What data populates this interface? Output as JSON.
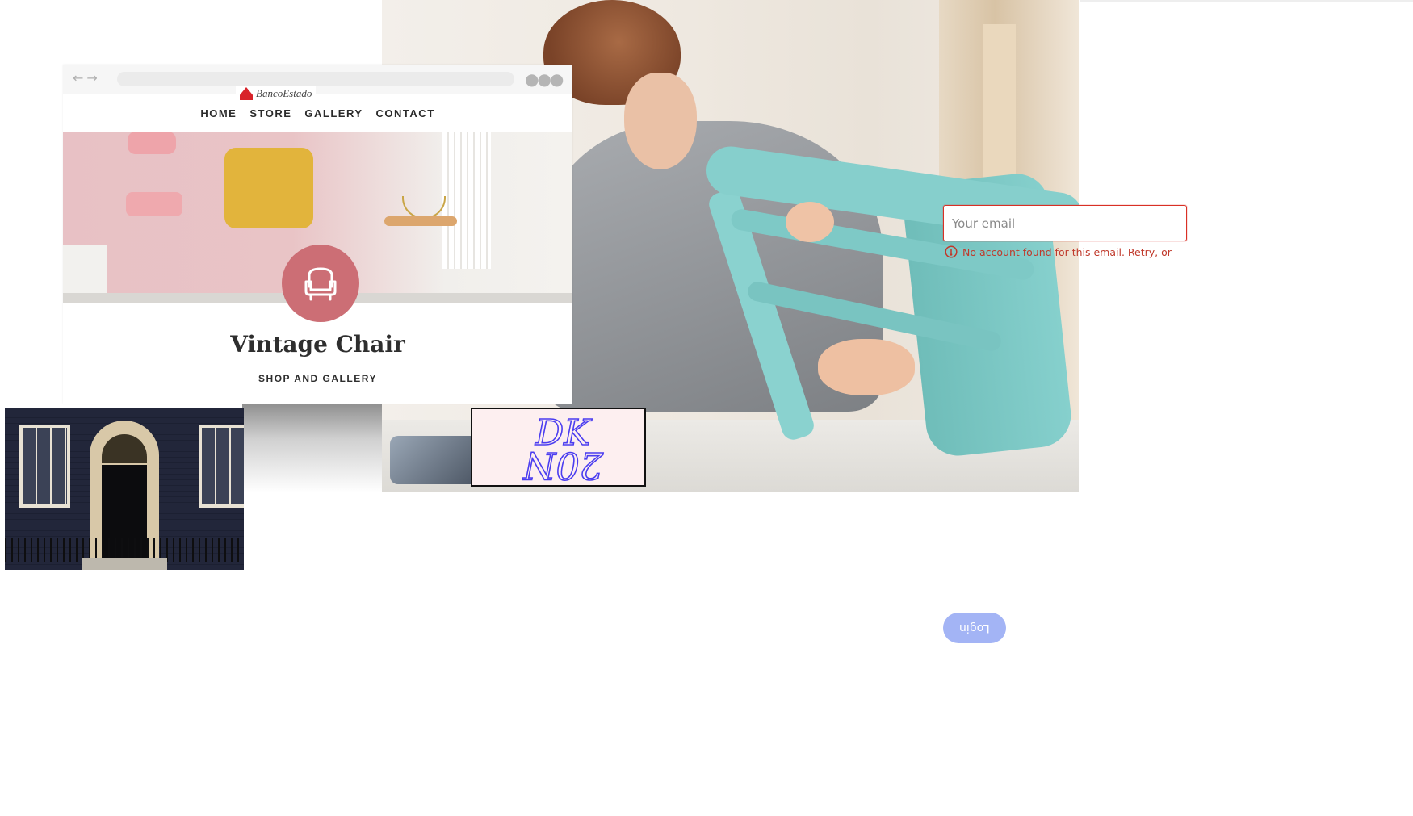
{
  "mockup": {
    "logo_text": "BancoEstado",
    "nav": [
      "HOME",
      "STORE",
      "GALLERY",
      "CONTACT"
    ],
    "title": "Vintage Chair",
    "subtitle": "SHOP AND GALLERY"
  },
  "captcha": {
    "line1": "DK",
    "line2": "20N"
  },
  "login": {
    "email_placeholder": "Your email",
    "error_text": "No account found for this email. Retry, or",
    "button_label": "Login"
  },
  "colors": {
    "error": "#d93025",
    "button": "#a3b4f5",
    "badge": "#cc6e75",
    "captcha_bg": "#fdeff0",
    "captcha_ink": "#4b3df0"
  },
  "icons": [
    "back-arrow-icon",
    "forward-arrow-icon",
    "more-dots-icon",
    "chair-icon",
    "alert-circle-icon"
  ]
}
